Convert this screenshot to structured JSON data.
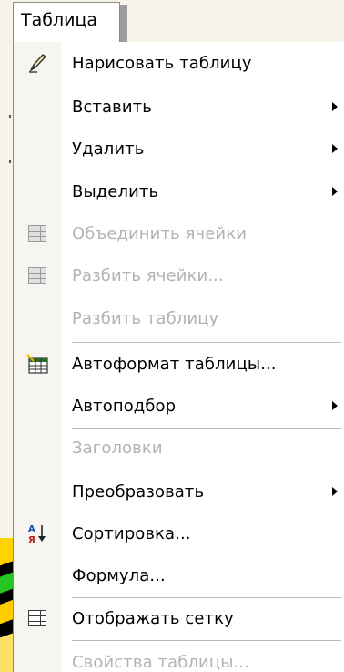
{
  "menubar": {
    "title": "Таблица"
  },
  "menu": {
    "items": [
      {
        "label": "Нарисовать таблицу",
        "icon": "pencil-icon",
        "enabled": true,
        "submenu": false
      },
      {
        "label": "Вставить",
        "icon": "",
        "enabled": true,
        "submenu": true
      },
      {
        "label": "Удалить",
        "icon": "",
        "enabled": true,
        "submenu": true
      },
      {
        "label": "Выделить",
        "icon": "",
        "enabled": true,
        "submenu": true
      },
      {
        "label": "Объединить ячейки",
        "icon": "merge-cells-icon",
        "enabled": false,
        "submenu": false
      },
      {
        "label": "Разбить ячейки...",
        "icon": "split-cells-icon",
        "enabled": false,
        "submenu": false
      },
      {
        "label": "Разбить таблицу",
        "icon": "",
        "enabled": false,
        "submenu": false
      },
      {
        "label": "Автоформат таблицы...",
        "icon": "table-autoformat-icon",
        "enabled": true,
        "submenu": false
      },
      {
        "label": "Автоподбор",
        "icon": "",
        "enabled": true,
        "submenu": true
      },
      {
        "label": "Заголовки",
        "icon": "",
        "enabled": false,
        "submenu": false
      },
      {
        "label": "Преобразовать",
        "icon": "",
        "enabled": true,
        "submenu": true
      },
      {
        "label": "Сортировка...",
        "icon": "sort-ascending-icon",
        "enabled": true,
        "submenu": false
      },
      {
        "label": "Формула...",
        "icon": "",
        "enabled": true,
        "submenu": false
      },
      {
        "label": "Отображать сетку",
        "icon": "show-gridlines-icon",
        "enabled": true,
        "submenu": false
      },
      {
        "label": "Свойства таблицы...",
        "icon": "",
        "enabled": false,
        "submenu": false
      }
    ]
  },
  "colors": {
    "menu_bg": "#ffffff",
    "gutter_bg": "#f6f5f1",
    "disabled_text": "#b3b3b3",
    "separator": "#b9b9b9"
  }
}
